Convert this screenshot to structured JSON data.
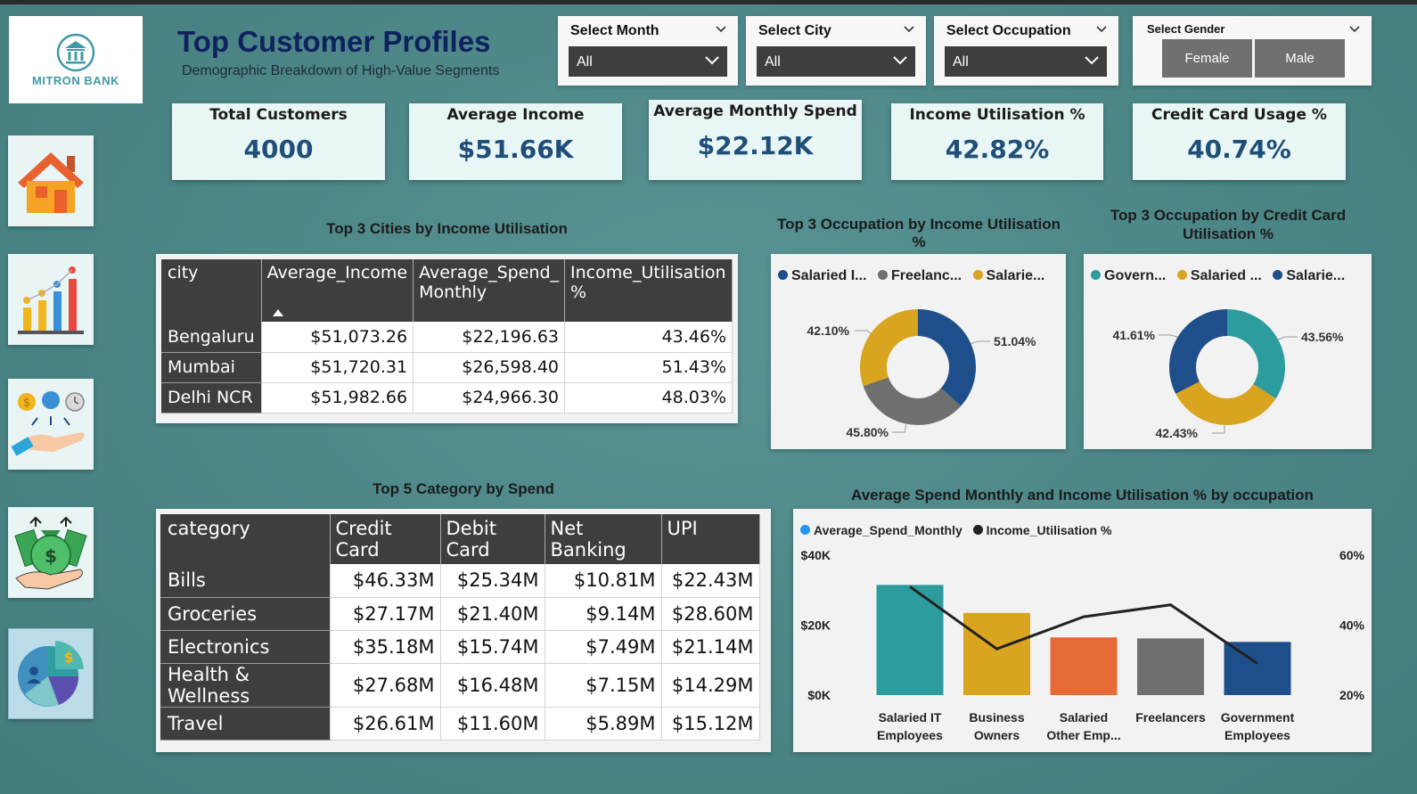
{
  "brand": {
    "name": "MITRON BANK"
  },
  "header": {
    "title": "Top Customer Profiles",
    "subtitle": "Demographic Breakdown of High-Value Segments"
  },
  "nav": [
    {
      "name": "home",
      "icon": "house-icon"
    },
    {
      "name": "trends",
      "icon": "bar-chart-icon"
    },
    {
      "name": "spending",
      "icon": "hand-coins-icon"
    },
    {
      "name": "income",
      "icon": "money-bag-icon"
    },
    {
      "name": "profiles",
      "icon": "pie-chart-icon",
      "active": true
    }
  ],
  "filters": {
    "month": {
      "label": "Select Month",
      "value": "All"
    },
    "city": {
      "label": "Select City",
      "value": "All"
    },
    "occupation": {
      "label": "Select Occupation",
      "value": "All"
    },
    "gender": {
      "label": "Select Gender",
      "options": [
        "Female",
        "Male"
      ]
    }
  },
  "kpis": [
    {
      "label": "Total Customers",
      "value": "4000"
    },
    {
      "label": "Average Income",
      "value": "$51.66K"
    },
    {
      "label": "Average Monthly Spend",
      "value": "$22.12K"
    },
    {
      "label": "Income Utilisation %",
      "value": "42.82%"
    },
    {
      "label": "Credit Card Usage %",
      "value": "40.74%"
    }
  ],
  "cities_table": {
    "title": "Top 3 Cities by Income Utilisation",
    "headers": [
      "city",
      "Average_Income",
      "Average_Spend_\nMonthly",
      "Income_Utilisation\n%"
    ],
    "rows": [
      [
        "Bengaluru",
        "$51,073.26",
        "$22,196.63",
        "43.46%"
      ],
      [
        "Mumbai",
        "$51,720.31",
        "$26,598.40",
        "51.43%"
      ],
      [
        "Delhi NCR",
        "$51,982.66",
        "$24,966.30",
        "48.03%"
      ]
    ]
  },
  "category_table": {
    "title": "Top 5 Category by Spend",
    "headers": [
      "category",
      "Credit Card",
      "Debit Card",
      "Net Banking",
      "UPI"
    ],
    "rows": [
      [
        "Bills",
        "$46.33M",
        "$25.34M",
        "$10.81M",
        "$22.43M"
      ],
      [
        "Groceries",
        "$27.17M",
        "$21.40M",
        "$9.14M",
        "$28.60M"
      ],
      [
        "Electronics",
        "$35.18M",
        "$15.74M",
        "$7.49M",
        "$21.14M"
      ],
      [
        "Health & Wellness",
        "$27.68M",
        "$16.48M",
        "$7.15M",
        "$14.29M"
      ],
      [
        "Travel",
        "$26.61M",
        "$11.60M",
        "$5.89M",
        "$15.12M"
      ]
    ]
  },
  "colors": {
    "teal": "#2d9c9f",
    "gold": "#d9a41f",
    "grey": "#6f6f6f",
    "navy": "#1f4f8a",
    "orange": "#e56a35",
    "kpi_value": "#1f4e79"
  },
  "chart_data": [
    {
      "type": "pie",
      "title": "Top 3 Occupation by Income Utilisation %",
      "legend": [
        "Salaried I...",
        "Freelanc...",
        "Salarie..."
      ],
      "slices": [
        {
          "name": "Salaried I...",
          "value": 51.04,
          "label": "51.04%",
          "color": "#1f4f8a"
        },
        {
          "name": "Freelanc...",
          "value": 45.8,
          "label": "45.80%",
          "color": "#6f6f6f"
        },
        {
          "name": "Salarie...",
          "value": 42.1,
          "label": "42.10%",
          "color": "#d9a41f"
        }
      ]
    },
    {
      "type": "pie",
      "title": "Top 3 Occupation by Credit Card Utilisation %",
      "legend": [
        "Govern...",
        "Salaried ...",
        "Salarie..."
      ],
      "slices": [
        {
          "name": "Govern...",
          "value": 43.56,
          "label": "43.56%",
          "color": "#2d9c9f"
        },
        {
          "name": "Salaried ...",
          "value": 42.43,
          "label": "42.43%",
          "color": "#d9a41f"
        },
        {
          "name": "Salarie...",
          "value": 41.61,
          "label": "41.61%",
          "color": "#1f4f8a"
        }
      ]
    },
    {
      "type": "bar",
      "title": "Average Spend Monthly and Income Utilisation % by occupation",
      "categories": [
        [
          "Salaried IT",
          "Employees"
        ],
        [
          "Business",
          "Owners"
        ],
        [
          "Salaried",
          "Other Emp..."
        ],
        [
          "Freelancers",
          ""
        ],
        [
          "Government",
          "Employees"
        ]
      ],
      "series": [
        {
          "name": "Average_Spend_Monthly",
          "values": [
            31500,
            23500,
            16500,
            16200,
            15200
          ],
          "colors": [
            "#2d9c9f",
            "#d9a41f",
            "#e56a35",
            "#6f6f6f",
            "#1f4f8a"
          ],
          "legend_color": "#2196f3"
        },
        {
          "name": "Income_Utilisation %",
          "values": [
            51.0,
            33.2,
            42.4,
            45.8,
            29.0
          ],
          "axis": "right",
          "color": "#222222"
        }
      ],
      "y_left": {
        "ticks": [
          "$0K",
          "$20K",
          "$40K"
        ],
        "range": [
          0,
          40000
        ]
      },
      "y_right": {
        "ticks": [
          "20%",
          "40%",
          "60%"
        ],
        "range": [
          20,
          60
        ]
      }
    }
  ]
}
